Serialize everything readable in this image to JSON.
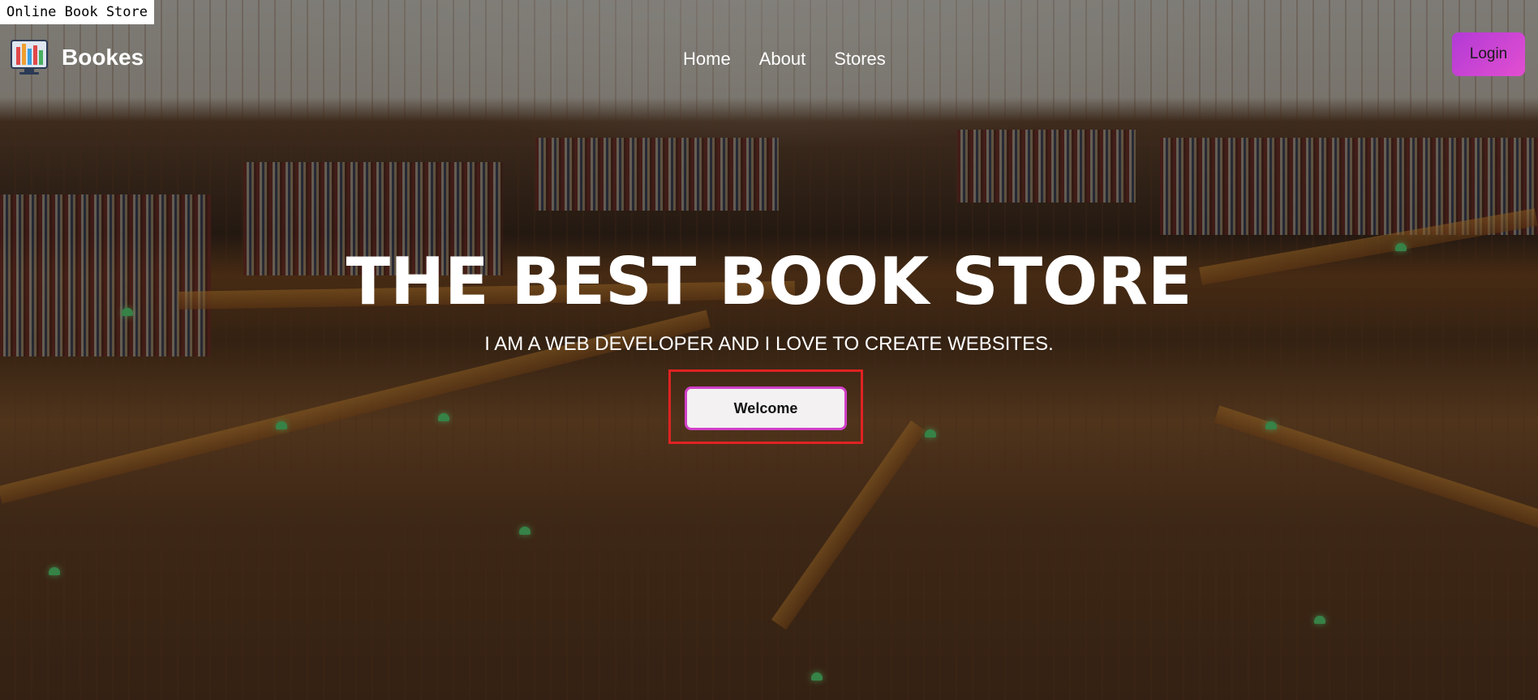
{
  "window": {
    "title": "Online Book Store"
  },
  "header": {
    "brand_name": "Bookes",
    "logo_icon": "books-monitor-icon",
    "nav": [
      {
        "label": "Home"
      },
      {
        "label": "About"
      },
      {
        "label": "Stores"
      }
    ],
    "login_label": "Login"
  },
  "hero": {
    "title": "THE BEST BOOK STORE",
    "subtitle": "I AM A WEB DEVELOPER AND I LOVE TO CREATE WEBSITES.",
    "welcome_label": "Welcome"
  },
  "colors": {
    "accent_gradient_start": "#b23ad6",
    "accent_gradient_end": "#e24fd0",
    "highlight_box": "#e02222",
    "welcome_border": "#d13fc8"
  }
}
